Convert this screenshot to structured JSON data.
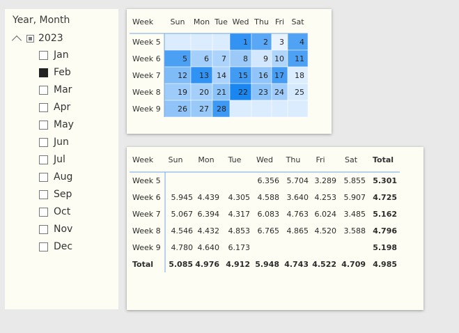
{
  "slicer": {
    "title": "Year, Month",
    "year": "2023",
    "months": [
      {
        "label": "Jan",
        "checked": false
      },
      {
        "label": "Feb",
        "checked": true
      },
      {
        "label": "Mar",
        "checked": false
      },
      {
        "label": "Apr",
        "checked": false
      },
      {
        "label": "May",
        "checked": false
      },
      {
        "label": "Jun",
        "checked": false
      },
      {
        "label": "Jul",
        "checked": false
      },
      {
        "label": "Aug",
        "checked": false
      },
      {
        "label": "Sep",
        "checked": false
      },
      {
        "label": "Oct",
        "checked": false
      },
      {
        "label": "Nov",
        "checked": false
      },
      {
        "label": "Dec",
        "checked": false
      }
    ]
  },
  "calendar": {
    "corner_header": "Week",
    "day_headers": [
      "Sun",
      "Mon",
      "Tue",
      "Wed",
      "Thu",
      "Fri",
      "Sat"
    ],
    "weeks": [
      {
        "label": "Week 5",
        "days": [
          null,
          null,
          null,
          1,
          2,
          3,
          4
        ]
      },
      {
        "label": "Week 6",
        "days": [
          5,
          6,
          7,
          8,
          9,
          10,
          11
        ]
      },
      {
        "label": "Week 7",
        "days": [
          12,
          13,
          14,
          15,
          16,
          17,
          18
        ]
      },
      {
        "label": "Week 8",
        "days": [
          19,
          20,
          21,
          22,
          23,
          24,
          25
        ]
      },
      {
        "label": "Week 9",
        "days": [
          26,
          27,
          28,
          null,
          null,
          null,
          null
        ]
      }
    ],
    "shading": [
      [
        null,
        null,
        null,
        6.356,
        5.704,
        3.289,
        5.855
      ],
      [
        5.945,
        4.439,
        4.305,
        4.588,
        3.64,
        4.253,
        5.907
      ],
      [
        5.067,
        6.394,
        4.317,
        6.083,
        4.763,
        6.024,
        3.485
      ],
      [
        4.546,
        4.432,
        4.853,
        6.765,
        4.865,
        4.52,
        3.588
      ],
      [
        4.78,
        4.64,
        6.173,
        null,
        null,
        null,
        null
      ]
    ],
    "colors": {
      "low": "#e8f3ff",
      "high": "#1a86f0",
      "empty": "#dcecff",
      "text": "#222222",
      "grid": "#6ea8e6"
    }
  },
  "matrix": {
    "corner_header": "Week",
    "column_headers": [
      "Sun",
      "Mon",
      "Tue",
      "Wed",
      "Thu",
      "Fri",
      "Sat",
      "Total"
    ],
    "rows": [
      {
        "label": "Week 5",
        "values": [
          "",
          "",
          "",
          "6.356",
          "5.704",
          "3.289",
          "5.855",
          "5.301"
        ]
      },
      {
        "label": "Week 6",
        "values": [
          "5.945",
          "4.439",
          "4.305",
          "4.588",
          "3.640",
          "4.253",
          "5.907",
          "4.725"
        ]
      },
      {
        "label": "Week 7",
        "values": [
          "5.067",
          "6.394",
          "4.317",
          "6.083",
          "4.763",
          "6.024",
          "3.485",
          "5.162"
        ]
      },
      {
        "label": "Week 8",
        "values": [
          "4.546",
          "4.432",
          "4.853",
          "6.765",
          "4.865",
          "4.520",
          "3.588",
          "4.796"
        ]
      },
      {
        "label": "Week 9",
        "values": [
          "4.780",
          "4.640",
          "6.173",
          "",
          "",
          "",
          "",
          "5.198"
        ]
      }
    ],
    "total_row": {
      "label": "Total",
      "values": [
        "5.085",
        "4.976",
        "4.912",
        "5.948",
        "4.743",
        "4.522",
        "4.709",
        "4.985"
      ]
    },
    "colors": {
      "text": "#2b2b2b",
      "rule": "#6ea8e6"
    }
  }
}
